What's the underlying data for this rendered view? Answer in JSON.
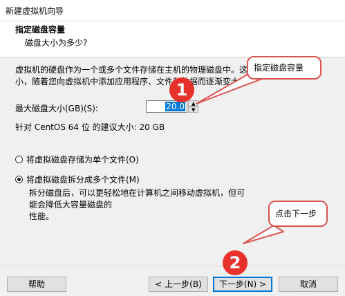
{
  "window": {
    "title": "新建虚拟机向导"
  },
  "header": {
    "title": "指定磁盘容量",
    "subtitle": "磁盘大小为多少?"
  },
  "content": {
    "description_line1": "虚拟机的硬盘作为一个或多个文件存储在主机的物理磁盘中。这",
    "description_line2": "小，随着您向虚拟机中添加应用程序、文件和数据而逐渐变大。",
    "size_label": "最大磁盘大小(GB)(S):",
    "size_value": "20.0",
    "recommend_text": "针对 CentOS 64 位 的建议大小: 20 GB",
    "radio_single": "将虚拟磁盘存储为单个文件(O)",
    "radio_split": "将虚拟磁盘拆分成多个文件(M)",
    "split_desc_line1": "拆分磁盘后，可以更轻松地在计算机之间移动虚拟机，但可能会降低大容量磁盘的",
    "split_desc_line2": "性能。"
  },
  "footer": {
    "help": "帮助",
    "back": "< 上一步(B)",
    "next": "下一步(N) >",
    "cancel": "取消"
  },
  "annotations": {
    "callout_1": "指定磁盘容量",
    "callout_2": "点击下一步",
    "marker_1": "1",
    "marker_2": "2"
  },
  "colors": {
    "accent": "#0078d7",
    "annotation_red": "#e8312b",
    "callout_border": "#d9534f"
  }
}
